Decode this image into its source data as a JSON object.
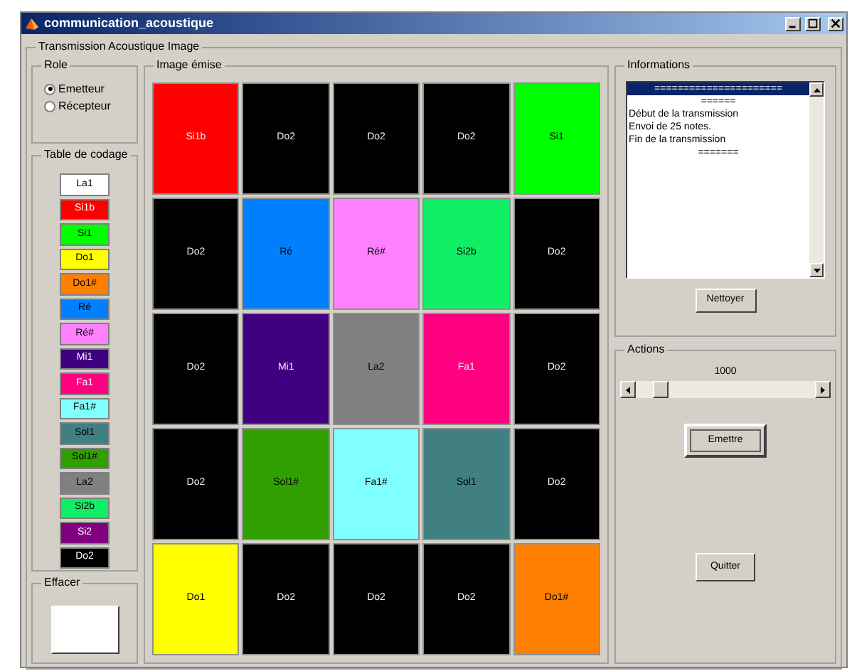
{
  "window": {
    "title": "communication_acoustique"
  },
  "panel_title": "Transmission Acoustique Image",
  "role": {
    "title": "Role",
    "options": [
      {
        "label": "Emetteur",
        "selected": true
      },
      {
        "label": "Récepteur",
        "selected": false
      }
    ]
  },
  "table": {
    "title": "Table de codage",
    "items": [
      {
        "label": "La1",
        "color": "#ffffff"
      },
      {
        "label": "Si1b",
        "color": "#ff0000"
      },
      {
        "label": "Si1",
        "color": "#00ff00"
      },
      {
        "label": "Do1",
        "color": "#ffff00"
      },
      {
        "label": "Do1#",
        "color": "#ff8000"
      },
      {
        "label": "Ré",
        "color": "#0080ff"
      },
      {
        "label": "Ré#",
        "color": "#ff80ff"
      },
      {
        "label": "Mi1",
        "color": "#400080"
      },
      {
        "label": "Fa1",
        "color": "#ff0080"
      },
      {
        "label": "Fa1#",
        "color": "#80ffff"
      },
      {
        "label": "Sol1",
        "color": "#408080"
      },
      {
        "label": "Sol1#",
        "color": "#30a000"
      },
      {
        "label": "La2",
        "color": "#808080"
      },
      {
        "label": "Si2b",
        "color": "#10ee66"
      },
      {
        "label": "Si2",
        "color": "#800080"
      },
      {
        "label": "Do2",
        "color": "#000000"
      }
    ]
  },
  "effacer": {
    "title": "Effacer"
  },
  "image": {
    "title": "Image émise",
    "cells": [
      {
        "label": "Si1b",
        "color": "#ff0000"
      },
      {
        "label": "Do2",
        "color": "#000000"
      },
      {
        "label": "Do2",
        "color": "#000000"
      },
      {
        "label": "Do2",
        "color": "#000000"
      },
      {
        "label": "Si1",
        "color": "#00ff00"
      },
      {
        "label": "Do2",
        "color": "#000000"
      },
      {
        "label": "Ré",
        "color": "#0080ff"
      },
      {
        "label": "Ré#",
        "color": "#ff80ff"
      },
      {
        "label": "Si2b",
        "color": "#10ee66"
      },
      {
        "label": "Do2",
        "color": "#000000"
      },
      {
        "label": "Do2",
        "color": "#000000"
      },
      {
        "label": "Mi1",
        "color": "#400080"
      },
      {
        "label": "La2",
        "color": "#808080"
      },
      {
        "label": "Fa1",
        "color": "#ff0080"
      },
      {
        "label": "Do2",
        "color": "#000000"
      },
      {
        "label": "Do2",
        "color": "#000000"
      },
      {
        "label": "Sol1#",
        "color": "#30a000"
      },
      {
        "label": "Fa1#",
        "color": "#80ffff"
      },
      {
        "label": "Sol1",
        "color": "#408080"
      },
      {
        "label": "Do2",
        "color": "#000000"
      },
      {
        "label": "Do1",
        "color": "#ffff00"
      },
      {
        "label": "Do2",
        "color": "#000000"
      },
      {
        "label": "Do2",
        "color": "#000000"
      },
      {
        "label": "Do2",
        "color": "#000000"
      },
      {
        "label": "Do1#",
        "color": "#ff8000"
      }
    ]
  },
  "informations": {
    "title": "Informations",
    "lines": [
      {
        "text": "======================",
        "selected": true
      },
      {
        "text": "======",
        "selected": false
      },
      {
        "text": "Début de la transmission",
        "selected": false
      },
      {
        "text": "Envoi de 25 notes.",
        "selected": false
      },
      {
        "text": "Fin de la transmission",
        "selected": false
      },
      {
        "text": "=======",
        "selected": false
      }
    ],
    "button": "Nettoyer"
  },
  "actions": {
    "title": "Actions",
    "value": "1000",
    "slider": {
      "level": 0.1
    },
    "emit_button": "Emettre",
    "quit_button": "Quitter"
  }
}
